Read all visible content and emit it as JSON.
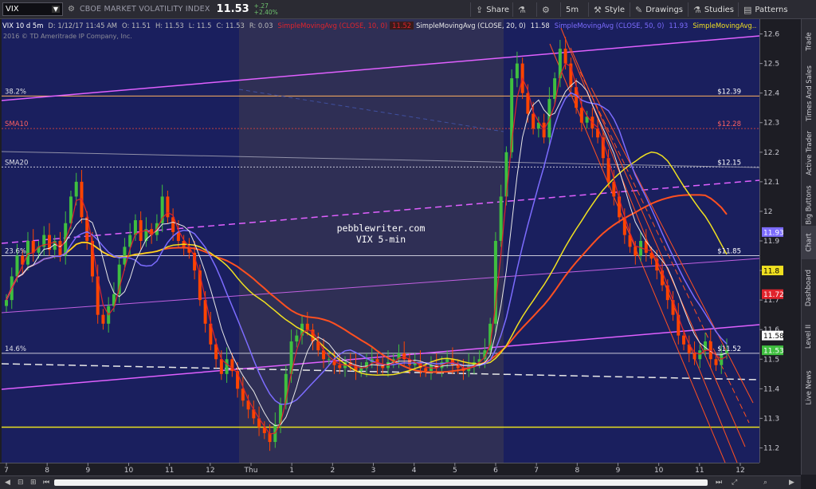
{
  "toolbar": {
    "symbol": "VIX",
    "description": "CBOE MARKET VOLATILITY INDEX",
    "last": "11.53",
    "change_abs": "+.27",
    "change_pct": "+2.40%",
    "share": "Share",
    "timeframe": "5m",
    "style": "Style",
    "drawings": "Drawings",
    "studies": "Studies",
    "patterns": "Patterns"
  },
  "infobar": {
    "symbol_period": "VIX 10 d 5m",
    "date": "D: 1/12/17 11:45 AM",
    "open": "O: 11.51",
    "high": "H: 11.53",
    "low": "L: 11.5",
    "close": "C: 11.53",
    "range": "R: 0.03",
    "sma10_label": "SimpleMovingAvg (CLOSE, 10, 0)",
    "sma10_value": "11.52",
    "sma20_label": "SimpleMovingAvg (CLOSE, 20, 0)",
    "sma20_value": "11.58",
    "sma50_label": "SimpleMovingAvg (CLOSE, 50, 0)",
    "sma50_value": "11.93",
    "sma_last_label": "SimpleMovingAvg..."
  },
  "copyright": "2016 © TD Ameritrade IP Company, Inc.",
  "colors": {
    "background": "#1a1f5e",
    "session_shade": "#2f2f55",
    "up_candle": "#3fbf3f",
    "down_candle": "#ff4400",
    "sma10": "#e0242c",
    "sma20": "#e8e8e8",
    "sma50": "#7c6cff",
    "sma_yellow": "#f0e020",
    "sma_red": "#ff5020",
    "trendline": "#e060ff"
  },
  "rightnav": [
    "Trade",
    "Times And Sales",
    "Active Trader",
    "Big Buttons",
    "Chart",
    "Dashboard",
    "Level II",
    "Live News"
  ],
  "chart_data": {
    "type": "line",
    "symbol": "VIX",
    "interval": "5m",
    "ylim": [
      11.15,
      12.65
    ],
    "y_ticks": [
      12.6,
      12.5,
      12.4,
      12.3,
      12.2,
      12.1,
      12,
      11.9,
      11.8,
      11.7,
      11.6,
      11.5,
      11.4,
      11.3,
      11.2
    ],
    "x_ticks": [
      "7",
      "8",
      "9",
      "10",
      "11",
      "12",
      "Thu",
      "1",
      "2",
      "3",
      "4",
      "5",
      "6",
      "7",
      "8",
      "9",
      "10",
      "11",
      "12"
    ],
    "horizontal_levels": [
      {
        "label": "38.2%",
        "value": 12.39,
        "price_label": "$12.39"
      },
      {
        "label": "SMA10",
        "value": 12.28,
        "price_label": "$12.28"
      },
      {
        "label": "SMA20",
        "value": 12.15,
        "price_label": "$12.15"
      },
      {
        "label": "23.6%",
        "value": 11.85,
        "price_label": "$11.85"
      },
      {
        "label": "14.6%",
        "value": 11.52,
        "price_label": "$11.52"
      },
      {
        "label": "",
        "value": 11.27,
        "price_label": ""
      }
    ],
    "price_tags": [
      {
        "value": 11.93,
        "text": "11.93",
        "color": "#7c6cff"
      },
      {
        "value": 11.8,
        "text": "11.8",
        "color": "#f0e020"
      },
      {
        "value": 11.72,
        "text": "11.72",
        "color": "#e0242c"
      },
      {
        "value": 11.58,
        "text": "11.58",
        "color": "#ffffff"
      },
      {
        "value": 11.53,
        "text": "11.53",
        "color": "#3fbf3f"
      }
    ],
    "closes": [
      11.7,
      11.78,
      11.85,
      11.82,
      11.9,
      11.86,
      11.88,
      11.92,
      11.87,
      11.9,
      11.85,
      11.96,
      12.05,
      12.1,
      11.98,
      11.9,
      11.78,
      11.65,
      11.62,
      11.68,
      11.72,
      11.82,
      11.88,
      11.92,
      11.97,
      11.9,
      11.94,
      11.92,
      11.96,
      12.05,
      11.98,
      11.93,
      11.9,
      11.88,
      11.86,
      11.8,
      11.7,
      11.62,
      11.55,
      11.5,
      11.45,
      11.5,
      11.46,
      11.4,
      11.36,
      11.33,
      11.3,
      11.27,
      11.25,
      11.22,
      11.28,
      11.35,
      11.45,
      11.56,
      11.58,
      11.62,
      11.6,
      11.56,
      11.53,
      11.5,
      11.5,
      11.48,
      11.47,
      11.49,
      11.48,
      11.46,
      11.47,
      11.49,
      11.5,
      11.48,
      11.47,
      11.49,
      11.5,
      11.52,
      11.5,
      11.48,
      11.49,
      11.47,
      11.46,
      11.48,
      11.47,
      11.49,
      11.5,
      11.48,
      11.47,
      11.46,
      11.48,
      11.49,
      11.5,
      11.53,
      11.62,
      11.9,
      12.05,
      12.2,
      12.45,
      12.5,
      12.4,
      12.33,
      12.28,
      12.3,
      12.25,
      12.38,
      12.45,
      12.55,
      12.5,
      12.42,
      12.35,
      12.3,
      12.32,
      12.28,
      12.25,
      12.18,
      12.1,
      12.05,
      11.98,
      11.92,
      11.88,
      11.85,
      11.9,
      11.86,
      11.84,
      11.8,
      11.75,
      11.7,
      11.65,
      11.58,
      11.55,
      11.52,
      11.5,
      11.53,
      11.56,
      11.5,
      11.48,
      11.52,
      11.53
    ],
    "annotation": "pebblewriter.com\nVIX 5-min"
  }
}
